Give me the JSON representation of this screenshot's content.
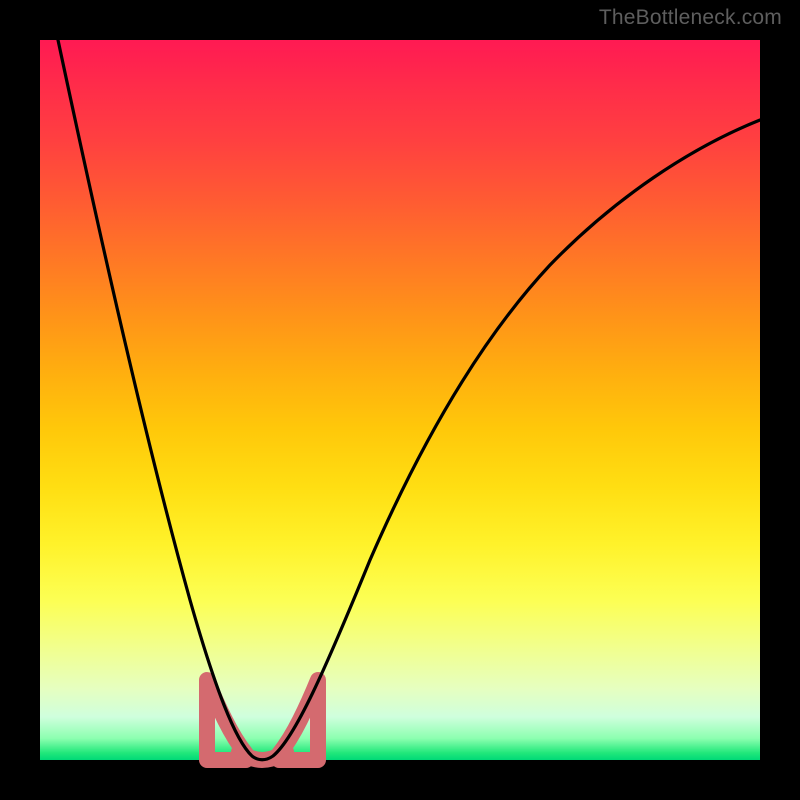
{
  "watermark": "TheBottleneck.com",
  "colors": {
    "frame": "#000000",
    "gradient_top": "#ff1a53",
    "gradient_bottom": "#00d977",
    "curve": "#000000",
    "overlay_band": "#d46a6f"
  },
  "chart_data": {
    "type": "line",
    "title": "",
    "xlabel": "",
    "ylabel": "",
    "xlim": [
      0,
      100
    ],
    "ylim": [
      0,
      100
    ],
    "x": [
      0,
      2,
      4,
      6,
      8,
      10,
      12,
      14,
      16,
      18,
      20,
      22,
      24,
      26,
      27,
      28,
      29,
      30,
      31,
      32,
      34,
      36,
      40,
      44,
      48,
      52,
      56,
      60,
      65,
      70,
      75,
      80,
      85,
      90,
      95,
      100
    ],
    "values": [
      100,
      91,
      82,
      74,
      67,
      60,
      53,
      47,
      41,
      35,
      29,
      23,
      17,
      11,
      8,
      5,
      2,
      0,
      2,
      5,
      11,
      17,
      27,
      36,
      43,
      49,
      54,
      59,
      64,
      68,
      71,
      74,
      77,
      79,
      81,
      83
    ],
    "optimum_x": 30,
    "overlay_band": {
      "y_min": 0,
      "y_max": 8,
      "x_min": 24,
      "x_max": 36
    }
  }
}
